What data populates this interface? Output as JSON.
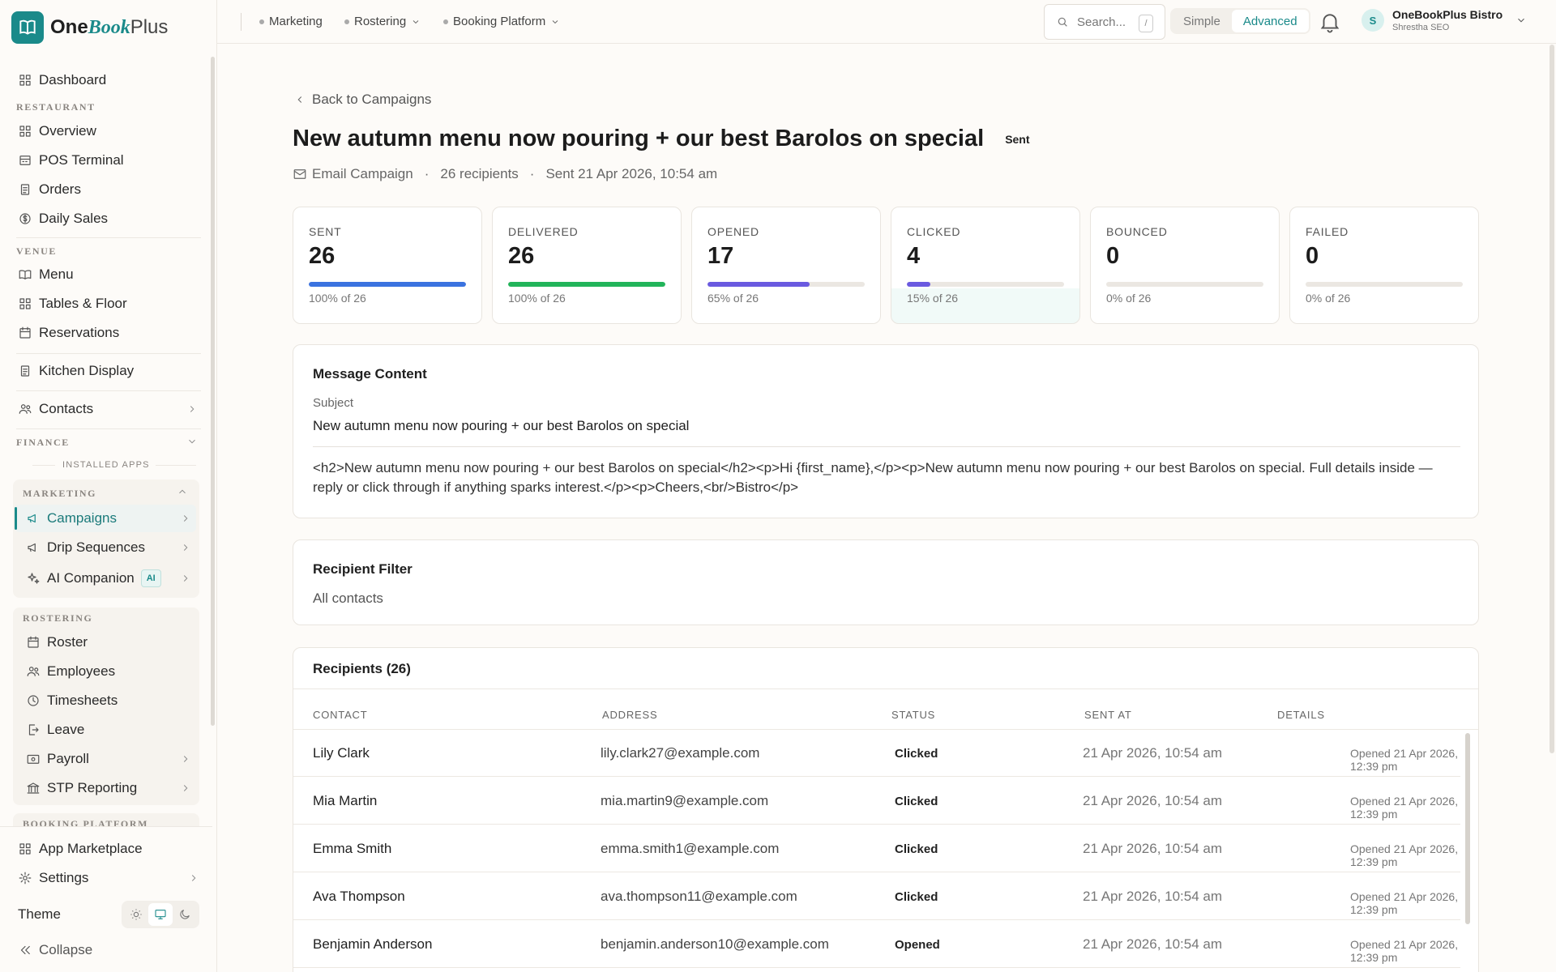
{
  "app": {
    "brand_one": "One",
    "brand_book": "Book",
    "brand_plus": "Plus"
  },
  "sidebar": {
    "dashboard": "Dashboard",
    "section_restaurant": "RESTAURANT",
    "overview": "Overview",
    "pos_terminal": "POS Terminal",
    "orders": "Orders",
    "daily_sales": "Daily Sales",
    "section_venue": "VENUE",
    "menu": "Menu",
    "tables_floor": "Tables & Floor",
    "reservations": "Reservations",
    "kitchen_display": "Kitchen Display",
    "contacts": "Contacts",
    "section_finance": "FINANCE",
    "installed_apps": "INSTALLED APPS",
    "section_marketing": "MARKETING",
    "campaigns": "Campaigns",
    "drip_sequences": "Drip Sequences",
    "ai_companion": "AI Companion",
    "ai_badge": "AI",
    "section_rostering": "ROSTERING",
    "roster": "Roster",
    "employees": "Employees",
    "timesheets": "Timesheets",
    "leave": "Leave",
    "payroll": "Payroll",
    "stp_reporting": "STP Reporting",
    "section_booking": "BOOKING PLATFORM",
    "app_marketplace": "App Marketplace",
    "settings": "Settings",
    "theme": "Theme",
    "collapse": "Collapse"
  },
  "topbar": {
    "crumb_marketing": "Marketing",
    "crumb_rostering": "Rostering",
    "crumb_booking": "Booking Platform",
    "search_placeholder": "Search...",
    "search_kbd": "/",
    "mode_simple": "Simple",
    "mode_advanced": "Advanced",
    "user_initial": "S",
    "user_name": "OneBookPlus Bistro",
    "user_sub": "Shrestha SEO"
  },
  "campaign": {
    "back": "Back to Campaigns",
    "title": "New autumn menu now pouring + our best Barolos on special",
    "status": "Sent",
    "type": "Email Campaign",
    "recipients": "26 recipients",
    "sent_at": "Sent 21 Apr 2026, 10:54 am"
  },
  "stats": [
    {
      "label": "SENT",
      "value": "26",
      "pct_text": "100% of 26",
      "fraction": 1.0,
      "color": "#3b73e0"
    },
    {
      "label": "DELIVERED",
      "value": "26",
      "pct_text": "100% of 26",
      "fraction": 1.0,
      "color": "#22b45a"
    },
    {
      "label": "OPENED",
      "value": "17",
      "pct_text": "65% of 26",
      "fraction": 0.65,
      "color": "#6a5ae0"
    },
    {
      "label": "CLICKED",
      "value": "4",
      "pct_text": "15% of 26",
      "fraction": 0.15,
      "color": "#6a5ae0"
    },
    {
      "label": "BOUNCED",
      "value": "0",
      "pct_text": "0% of 26",
      "fraction": 0,
      "color": "#e0dcd6"
    },
    {
      "label": "FAILED",
      "value": "0",
      "pct_text": "0% of 26",
      "fraction": 0,
      "color": "#e0dcd6"
    }
  ],
  "message": {
    "title": "Message Content",
    "subject_label": "Subject",
    "subject": "New autumn menu now pouring + our best Barolos on special",
    "body": "<h2>New autumn menu now pouring + our best Barolos on special</h2><p>Hi {first_name},</p><p>New autumn menu now pouring + our best Barolos on special. Full details inside — reply or click through if anything sparks interest.</p><p>Cheers,<br/>Bistro</p>"
  },
  "filter": {
    "title": "Recipient Filter",
    "value": "All contacts"
  },
  "recipients": {
    "title": "Recipients (26)",
    "columns": [
      "CONTACT",
      "ADDRESS",
      "STATUS",
      "SENT AT",
      "DETAILS"
    ],
    "rows": [
      {
        "contact": "Lily Clark",
        "address": "lily.clark27@example.com",
        "status": "Clicked",
        "sent_at": "21 Apr 2026, 10:54 am",
        "details": "Opened 21 Apr 2026, 12:39 pm"
      },
      {
        "contact": "Mia Martin",
        "address": "mia.martin9@example.com",
        "status": "Clicked",
        "sent_at": "21 Apr 2026, 10:54 am",
        "details": "Opened 21 Apr 2026, 12:39 pm"
      },
      {
        "contact": "Emma Smith",
        "address": "emma.smith1@example.com",
        "status": "Clicked",
        "sent_at": "21 Apr 2026, 10:54 am",
        "details": "Opened 21 Apr 2026, 12:39 pm"
      },
      {
        "contact": "Ava Thompson",
        "address": "ava.thompson11@example.com",
        "status": "Clicked",
        "sent_at": "21 Apr 2026, 10:54 am",
        "details": "Opened 21 Apr 2026, 12:39 pm"
      },
      {
        "contact": "Benjamin Anderson",
        "address": "benjamin.anderson10@example.com",
        "status": "Opened",
        "sent_at": "21 Apr 2026, 10:54 am",
        "details": "Opened 21 Apr 2026, 12:39 pm"
      }
    ]
  }
}
